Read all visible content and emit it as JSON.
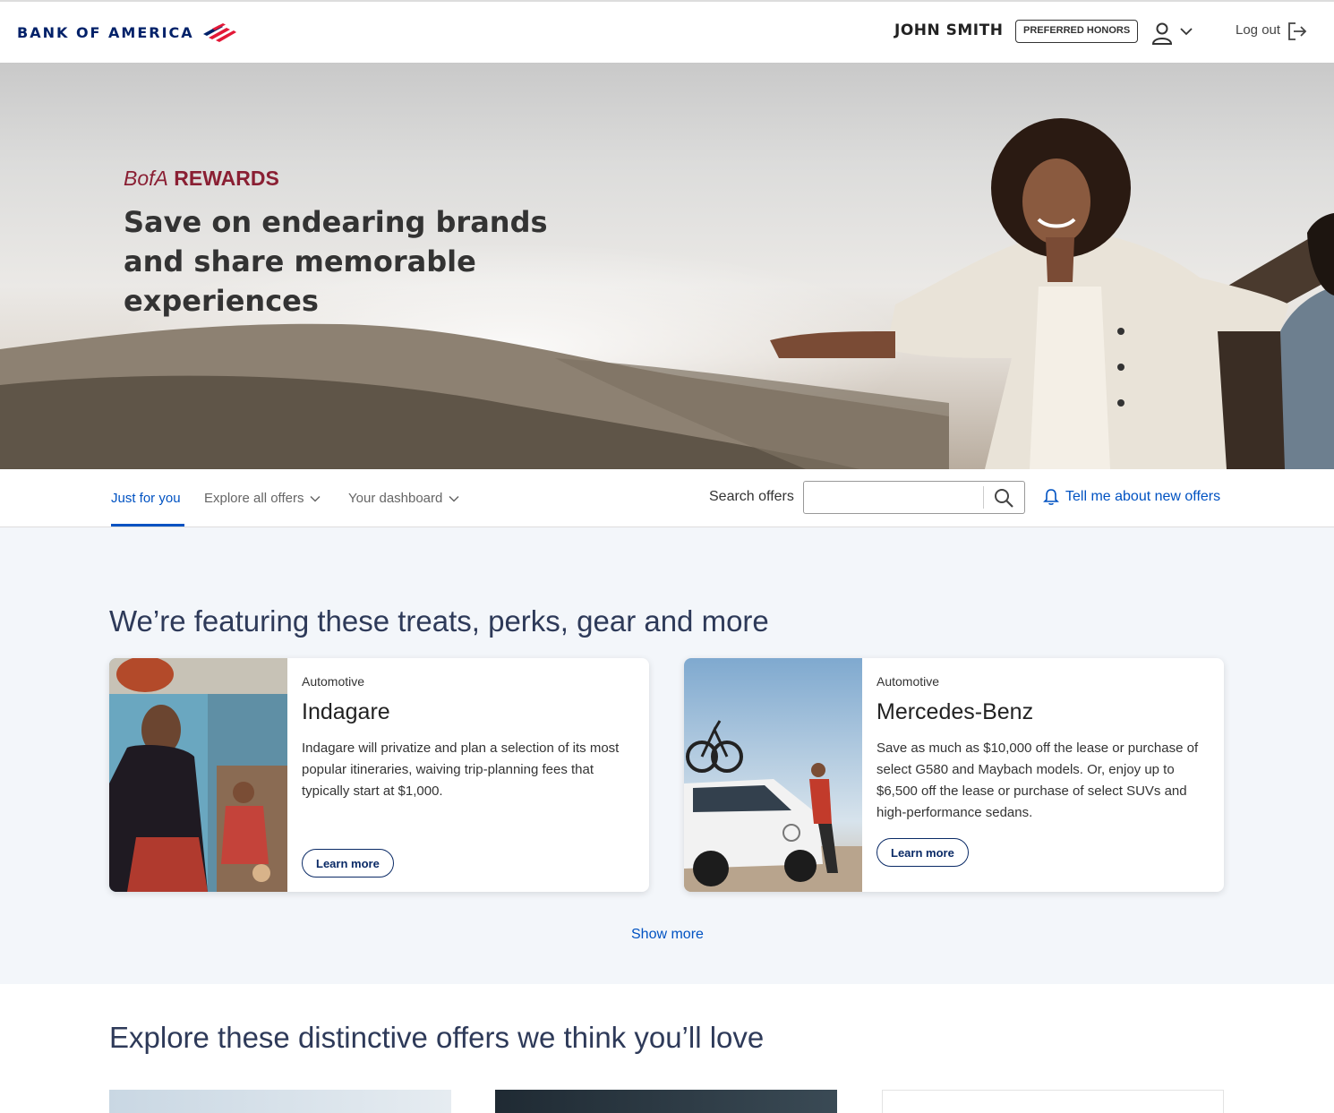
{
  "header": {
    "logo_text": "BANK OF AMERICA",
    "user_name": "JOHN SMITH",
    "tier_badge": "PREFERRED HONORS",
    "logout_label": "Log out"
  },
  "hero": {
    "eyebrow_brand": "BofA",
    "eyebrow_program": "REWARDS",
    "title": "Save on endearing brands and share memorable experiences"
  },
  "nav": {
    "tabs": [
      {
        "label": "Just for you",
        "active": true
      },
      {
        "label": "Explore all offers",
        "active": false
      },
      {
        "label": "Your dashboard",
        "active": false
      }
    ],
    "search_label": "Search offers",
    "search_value": "",
    "alert_link": "Tell me about new offers"
  },
  "featured": {
    "title": "We’re featuring these treats, perks, gear and more",
    "cards": [
      {
        "category": "Automotive",
        "name": "Indagare",
        "description": "Indagare will privatize and plan a selection of its most popular itineraries, waiving trip-planning fees that typically start at $1,000.",
        "button": "Learn more"
      },
      {
        "category": "Automotive",
        "name": "Mercedes-Benz",
        "description": "Save as much as $10,000 off the lease or purchase of select G580 and Maybach models. Or, enjoy up to $6,500 off the lease or purchase of select SUVs and high-performance sedans.",
        "button": "Learn more"
      }
    ],
    "show_more": "Show more"
  },
  "explore": {
    "title": "Explore these distinctive offers we think you’ll love"
  },
  "colors": {
    "brand_navy": "#012169",
    "brand_red": "#e31837",
    "link_blue": "#0052c2",
    "rewards_red": "#8a1f33"
  }
}
